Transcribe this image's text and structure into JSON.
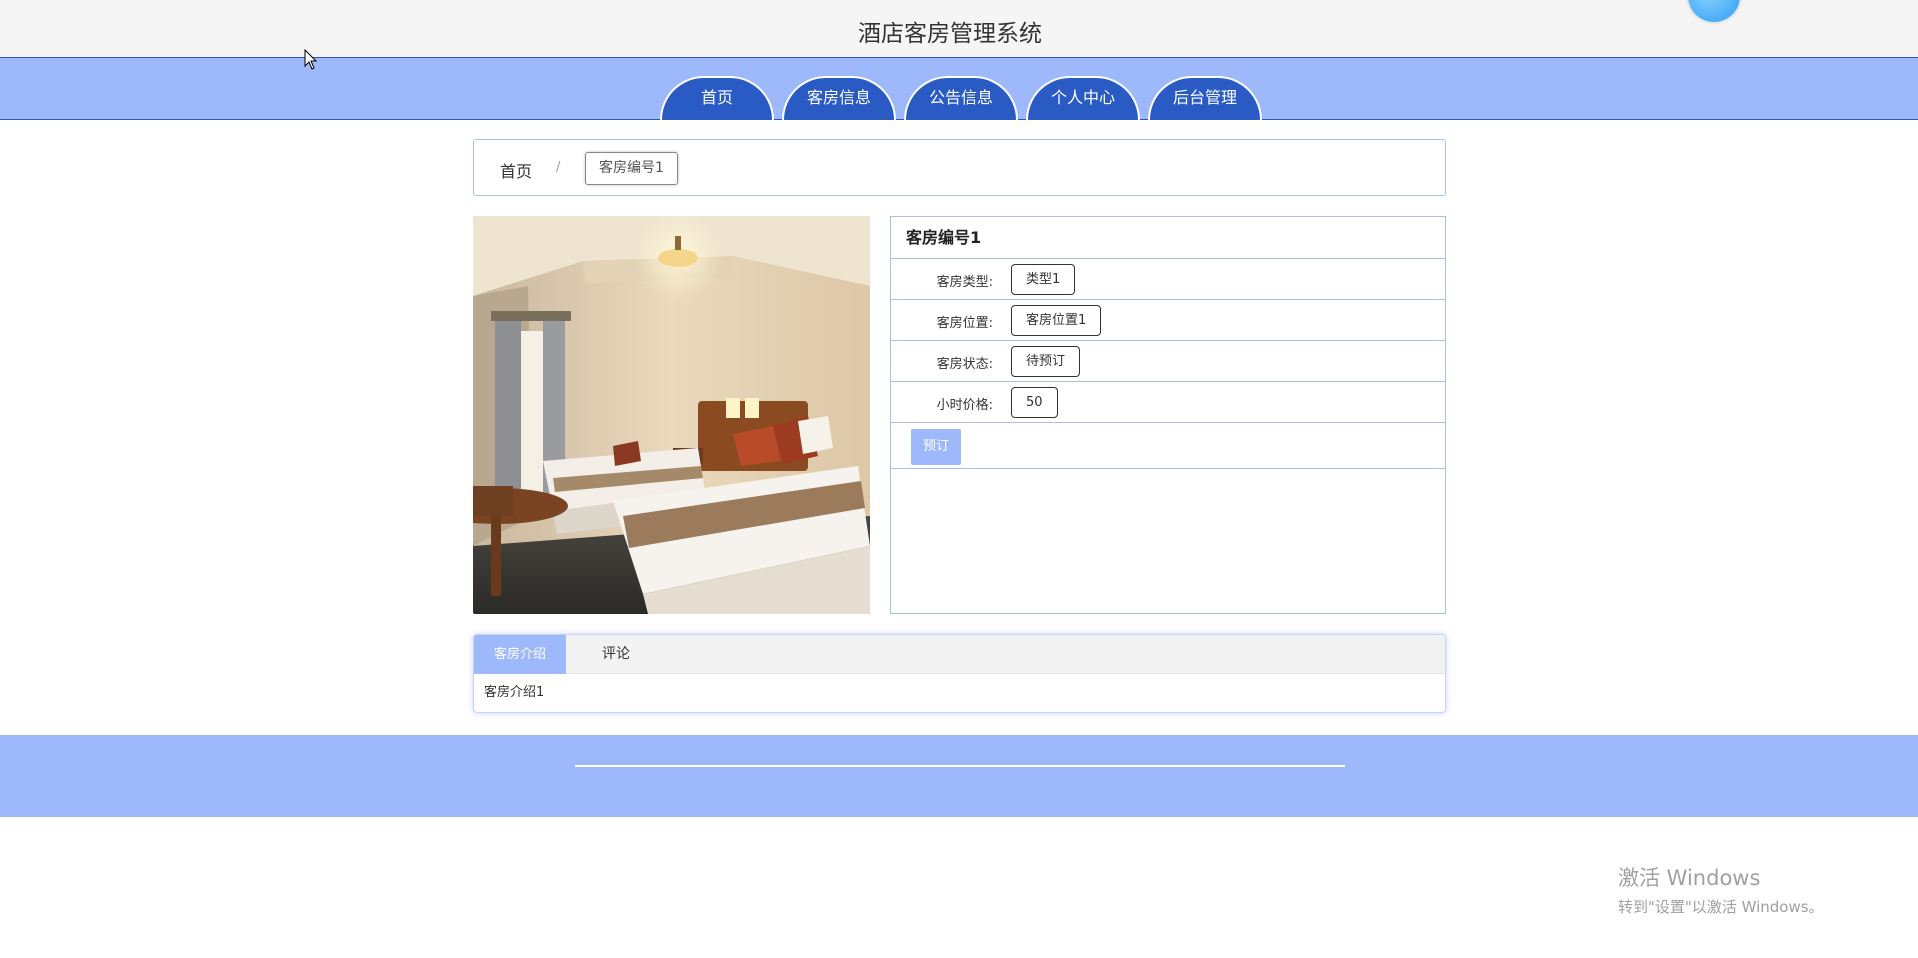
{
  "header": {
    "title": "酒店客房管理系统"
  },
  "nav": {
    "items": [
      {
        "label": "首页"
      },
      {
        "label": "客房信息"
      },
      {
        "label": "公告信息"
      },
      {
        "label": "个人中心"
      },
      {
        "label": "后台管理"
      }
    ]
  },
  "breadcrumb": {
    "home": "首页",
    "separator": "/",
    "current": "客房编号1"
  },
  "room": {
    "title": "客房编号1",
    "fields": [
      {
        "label": "客房类型:",
        "value": "类型1"
      },
      {
        "label": "客房位置:",
        "value": "客房位置1"
      },
      {
        "label": "客房状态:",
        "value": "待预订"
      },
      {
        "label": "小时价格:",
        "value": "50"
      }
    ],
    "book_label": "预订"
  },
  "tabs": {
    "items": [
      {
        "label": "客房介绍"
      },
      {
        "label": "评论"
      }
    ],
    "active_content": "客房介绍1"
  },
  "watermark": {
    "line1": "激活 Windows",
    "line2": "转到\"设置\"以激活 Windows。"
  },
  "colors": {
    "primary": "#9db8fb",
    "nav_tab": "#2a5bc4",
    "border": "#a8c0ee"
  }
}
